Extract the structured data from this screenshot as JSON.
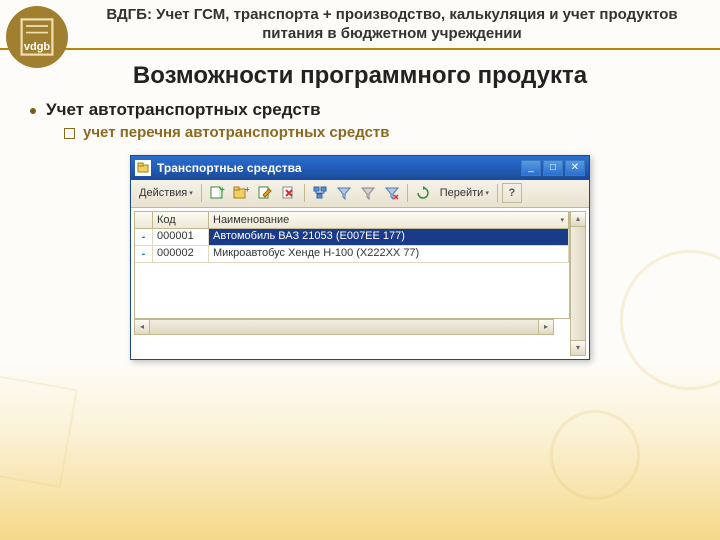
{
  "header": {
    "title": "ВДГБ: Учет ГСМ, транспорта + производство, калькуляция и учет продуктов питания в бюджетном учреждении"
  },
  "title": "Возможности программного продукта",
  "bullet": {
    "main": "Учет автотранспортных средств",
    "sub": "учет перечня автотранспортных средств"
  },
  "window": {
    "title": "Транспортные средства",
    "actions_menu": "Действия",
    "goto_menu": "Перейти",
    "help_btn": "?",
    "columns": {
      "code": "Код",
      "name": "Наименование"
    },
    "rows": [
      {
        "code": "000001",
        "name": "Автомобиль ВАЗ 21053 (Е007ЕЕ 177)"
      },
      {
        "code": "000002",
        "name": "Микроавтобус Хенде Н-100 (Х222ХХ 77)"
      }
    ]
  }
}
